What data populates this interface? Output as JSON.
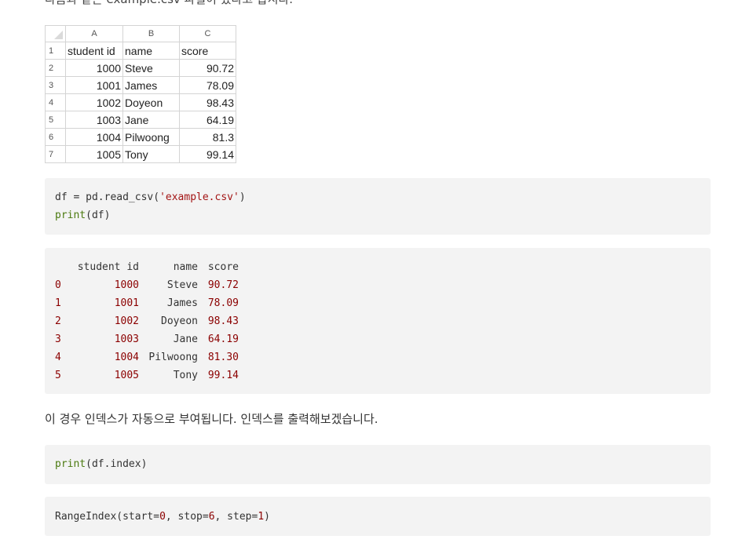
{
  "intro_text": "다음과 같은 example.csv 파일이 있다고 합시다.",
  "spreadsheet": {
    "columns": [
      "A",
      "B",
      "C"
    ],
    "rows": [
      {
        "n": "1",
        "a": "student id",
        "b": "name",
        "c": "score"
      },
      {
        "n": "2",
        "a": "1000",
        "b": "Steve",
        "c": "90.72"
      },
      {
        "n": "3",
        "a": "1001",
        "b": "James",
        "c": "78.09"
      },
      {
        "n": "4",
        "a": "1002",
        "b": "Doyeon",
        "c": "98.43"
      },
      {
        "n": "5",
        "a": "1003",
        "b": "Jane",
        "c": "64.19"
      },
      {
        "n": "6",
        "a": "1004",
        "b": "Pilwoong",
        "c": "81.3"
      },
      {
        "n": "7",
        "a": "1005",
        "b": "Tony",
        "c": "99.14"
      }
    ]
  },
  "code1": {
    "line1_pre": "df = pd.read_csv(",
    "line1_str": "'example.csv'",
    "line1_post": ")",
    "line2_kw": "print",
    "line2_post": "(df)"
  },
  "output1": {
    "headers": [
      "student id",
      "name",
      "score"
    ],
    "rows": [
      {
        "idx": "0",
        "sid": "1000",
        "name": "Steve",
        "score": "90.72"
      },
      {
        "idx": "1",
        "sid": "1001",
        "name": "James",
        "score": "78.09"
      },
      {
        "idx": "2",
        "sid": "1002",
        "name": "Doyeon",
        "score": "98.43"
      },
      {
        "idx": "3",
        "sid": "1003",
        "name": "Jane",
        "score": "64.19"
      },
      {
        "idx": "4",
        "sid": "1004",
        "name": "Pilwoong",
        "score": "81.30"
      },
      {
        "idx": "5",
        "sid": "1005",
        "name": "Tony",
        "score": "99.14"
      }
    ]
  },
  "paragraph": "이 경우 인덱스가 자동으로 부여됩니다. 인덱스를 출력해보겠습니다.",
  "code2": {
    "kw": "print",
    "post": "(df.index)"
  },
  "output2": {
    "p1": "RangeIndex(start=",
    "n1": "0",
    "p2": ", stop=",
    "n2": "6",
    "p3": ", step=",
    "n3": "1",
    "p4": ")"
  }
}
